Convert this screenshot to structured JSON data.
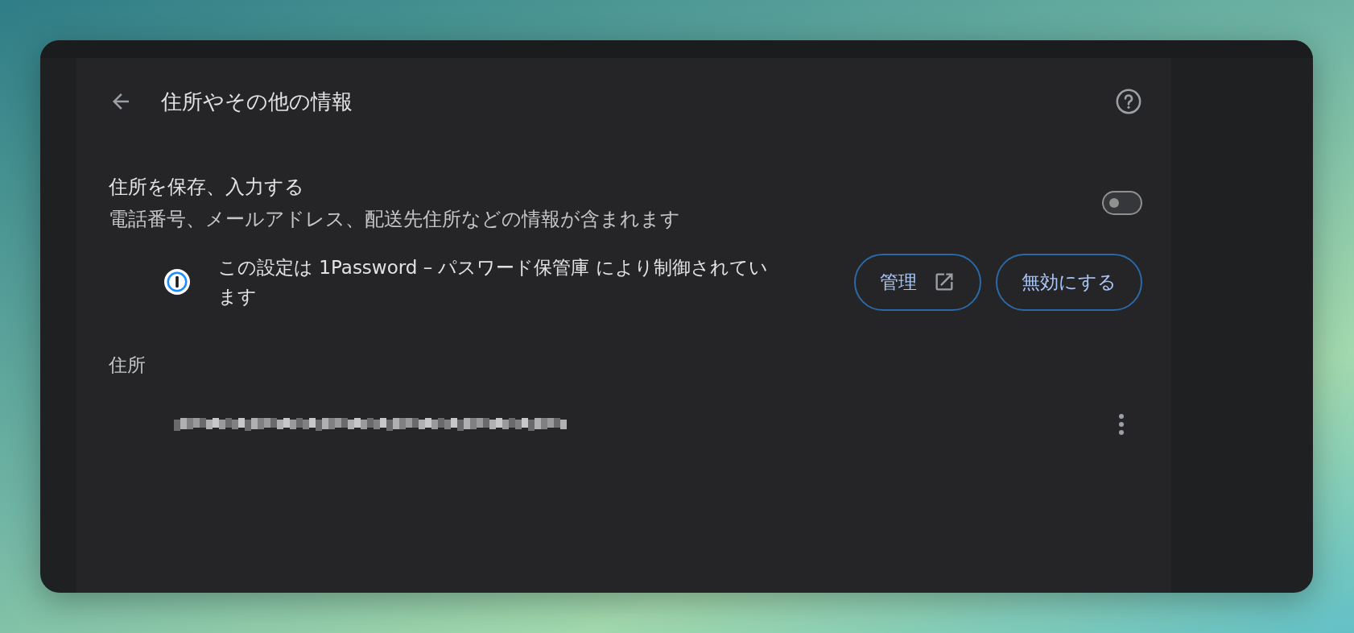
{
  "header": {
    "title": "住所やその他の情報"
  },
  "save_setting": {
    "title": "住所を保存、入力する",
    "description": "電話番号、メールアドレス、配送先住所などの情報が含まれます",
    "on": false
  },
  "managed_notice": {
    "text": "この設定は 1Password – パスワード保管庫 により制御されています",
    "buttons": [
      {
        "label": "管理",
        "kind": "external"
      },
      {
        "label": "無効にする",
        "kind": "plain"
      }
    ]
  },
  "addresses_section": {
    "heading": "住所",
    "items": [
      {
        "kind": "redacted"
      }
    ]
  }
}
